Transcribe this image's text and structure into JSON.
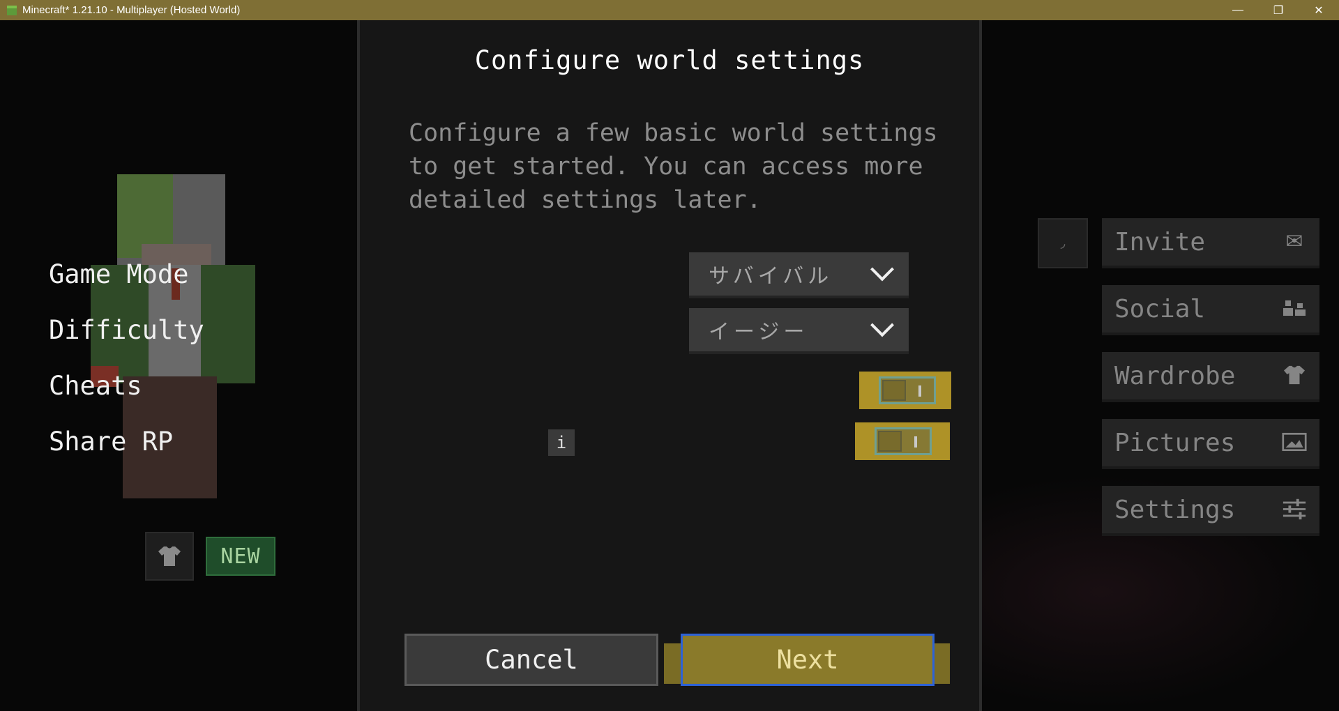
{
  "window": {
    "title": "Minecraft* 1.21.10 - Multiplayer (Hosted World)",
    "minimize": "—",
    "restore": "❐",
    "close": "✕"
  },
  "character": {
    "new_badge": "NEW",
    "wardrobe_icon": "shirt-icon"
  },
  "dialog": {
    "title": "Configure world settings",
    "description": "Configure a few basic world settings to get started. You can access more detailed settings later.",
    "game_mode": {
      "label": "Game Mode",
      "value": "サバイバル"
    },
    "difficulty": {
      "label": "Difficulty",
      "value": "イージー"
    },
    "cheats": {
      "label": "Cheats",
      "on": false
    },
    "share_rp": {
      "label": "Share RP",
      "info": "i",
      "on": false
    },
    "cancel_label": "Cancel",
    "next_label": "Next",
    "accent": "#c9a82a",
    "focus_color": "#2d62d6"
  },
  "side_menu": {
    "feed_icon": "feed-icon",
    "items": [
      {
        "label": "Invite",
        "icon": "envelope-icon",
        "glyph": "✉"
      },
      {
        "label": "Social",
        "icon": "people-icon",
        "glyph": "👥"
      },
      {
        "label": "Wardrobe",
        "icon": "shirt-icon",
        "glyph": "👕"
      },
      {
        "label": "Pictures",
        "icon": "picture-icon",
        "glyph": "🖼"
      },
      {
        "label": "Settings",
        "icon": "sliders-icon",
        "glyph": "☰"
      }
    ]
  }
}
